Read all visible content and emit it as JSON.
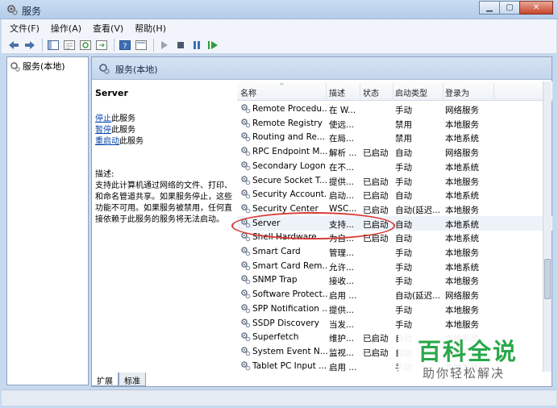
{
  "window": {
    "title": "服务"
  },
  "menu": [
    "文件(F)",
    "操作(A)",
    "查看(V)",
    "帮助(H)"
  ],
  "tree": {
    "root_label": "服务(本地)"
  },
  "pane": {
    "header": "服务(本地)"
  },
  "detail": {
    "service_name": "Server",
    "stop_link": "停止",
    "stop_suffix": "此服务",
    "pause_link": "暂停",
    "pause_suffix": "此服务",
    "restart_link": "重启动",
    "restart_suffix": "此服务",
    "desc_label": "描述:",
    "desc_text": "支持此计算机通过网络的文件、打印、和命名管道共享。如果服务停止，这些功能不可用。如果服务被禁用，任何直接依赖于此服务的服务将无法启动。"
  },
  "columns": [
    "名称",
    "描述",
    "状态",
    "启动类型",
    "登录为"
  ],
  "rows": [
    {
      "name": "Remote Procedu...",
      "desc": "在 W...",
      "status": "",
      "startup": "手动",
      "logon": "网络服务"
    },
    {
      "name": "Remote Registry",
      "desc": "使远...",
      "status": "",
      "startup": "禁用",
      "logon": "本地服务"
    },
    {
      "name": "Routing and Re...",
      "desc": "在局...",
      "status": "",
      "startup": "禁用",
      "logon": "本地系统"
    },
    {
      "name": "RPC Endpoint M...",
      "desc": "解析 ...",
      "status": "已启动",
      "startup": "自动",
      "logon": "网络服务"
    },
    {
      "name": "Secondary Logon",
      "desc": "在不...",
      "status": "",
      "startup": "手动",
      "logon": "本地系统"
    },
    {
      "name": "Secure Socket T...",
      "desc": "提供...",
      "status": "已启动",
      "startup": "手动",
      "logon": "本地服务"
    },
    {
      "name": "Security Account...",
      "desc": "启动...",
      "status": "已启动",
      "startup": "自动",
      "logon": "本地系统"
    },
    {
      "name": "Security Center",
      "desc": "WSC...",
      "status": "已启动",
      "startup": "自动(延迟...",
      "logon": "本地服务"
    },
    {
      "name": "Server",
      "desc": "支持...",
      "status": "已启动",
      "startup": "自动",
      "logon": "本地系统"
    },
    {
      "name": "Shell Hardware ...",
      "desc": "为自...",
      "status": "已启动",
      "startup": "自动",
      "logon": "本地系统"
    },
    {
      "name": "Smart Card",
      "desc": "管理...",
      "status": "",
      "startup": "手动",
      "logon": "本地服务"
    },
    {
      "name": "Smart Card Rem...",
      "desc": "允许...",
      "status": "",
      "startup": "手动",
      "logon": "本地系统"
    },
    {
      "name": "SNMP Trap",
      "desc": "接收...",
      "status": "",
      "startup": "手动",
      "logon": "本地服务"
    },
    {
      "name": "Software Protect...",
      "desc": "启用 ...",
      "status": "",
      "startup": "自动(延迟...",
      "logon": "网络服务"
    },
    {
      "name": "SPP Notification ...",
      "desc": "提供...",
      "status": "",
      "startup": "手动",
      "logon": "本地服务"
    },
    {
      "name": "SSDP Discovery",
      "desc": "当发...",
      "status": "",
      "startup": "手动",
      "logon": "本地服务"
    },
    {
      "name": "Superfetch",
      "desc": "维护...",
      "status": "已启动",
      "startup": "自动",
      "logon": "本地系统"
    },
    {
      "name": "System Event N...",
      "desc": "监视...",
      "status": "已启动",
      "startup": "自动",
      "logon": "本地系统"
    },
    {
      "name": "Tablet PC Input ...",
      "desc": "启用 ...",
      "status": "",
      "startup": "手动",
      "logon": "本地系统"
    }
  ],
  "selected_row": 8,
  "tabs": [
    "扩展",
    "标准"
  ],
  "watermark": {
    "title": "百科全说",
    "subtitle": "助你轻松解决"
  },
  "icons": [
    "back-icon",
    "forward-icon",
    "console-tree-icon",
    "properties-icon",
    "refresh-icon",
    "export-icon",
    "help-icon",
    "view-icon",
    "start-icon",
    "stop-icon",
    "pause-icon",
    "restart-icon",
    "gear-icon"
  ],
  "colors": {
    "link": "#0645ad",
    "highlight_oval": "#d93a35",
    "watermark_green": "#2aa84a"
  }
}
